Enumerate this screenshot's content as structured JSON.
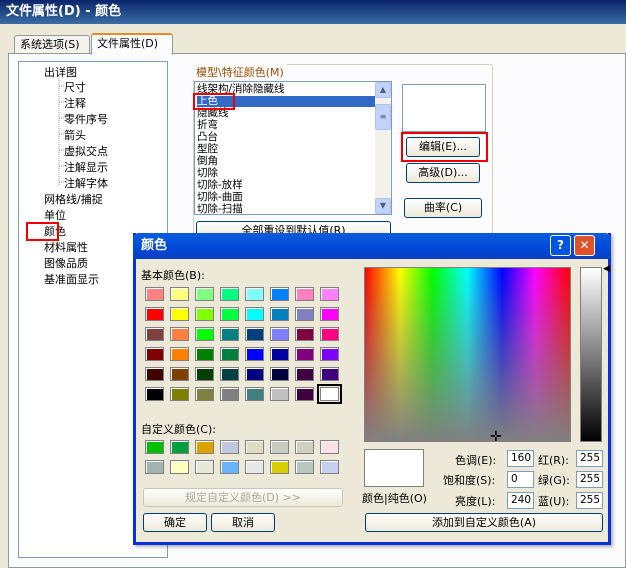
{
  "window": {
    "title": "文件属性(D) - 颜色"
  },
  "tabs": [
    {
      "label": "系统选项(S)"
    },
    {
      "label": "文件属性(D)"
    }
  ],
  "tree": {
    "items": [
      {
        "label": "出详图"
      },
      {
        "label": "尺寸"
      },
      {
        "label": "注释"
      },
      {
        "label": "零件序号"
      },
      {
        "label": "箭头"
      },
      {
        "label": "虚拟交点"
      },
      {
        "label": "注解显示"
      },
      {
        "label": "注解字体"
      },
      {
        "label": "网格线/捕捉"
      },
      {
        "label": "单位"
      },
      {
        "label": "颜色"
      },
      {
        "label": "材料属性"
      },
      {
        "label": "图像品质"
      },
      {
        "label": "基准面显示"
      }
    ]
  },
  "model_colors": {
    "group_label": "模型\\特征颜色(M)",
    "items": [
      "线架构/消除隐藏线",
      "上色",
      "隐藏线",
      "折弯",
      "凸台",
      "型腔",
      "倒角",
      "切除",
      "切除-放样",
      "切除-曲面",
      "切除-扫描"
    ],
    "selected_index": 1,
    "edit_button": "编辑(E)...",
    "advanced_button": "高级(D)...",
    "curvature_button": "曲率(C)",
    "reset_button": "全部重设到默认值(R)"
  },
  "color_dialog": {
    "title": "颜色",
    "help_btn": "?",
    "close_btn": "✕",
    "basic_colors_label": "基本颜色(B):",
    "basic_colors": [
      "#ff8080",
      "#ffff80",
      "#80ff80",
      "#00ff80",
      "#80ffff",
      "#0080ff",
      "#ff80c0",
      "#ff80ff",
      "#ff0000",
      "#ffff00",
      "#80ff00",
      "#00ff40",
      "#00ffff",
      "#0080c0",
      "#8080c0",
      "#ff00ff",
      "#804040",
      "#ff8040",
      "#00ff00",
      "#008080",
      "#004080",
      "#8080ff",
      "#800040",
      "#ff0080",
      "#800000",
      "#ff8000",
      "#008000",
      "#008040",
      "#0000ff",
      "#0000a0",
      "#800080",
      "#8000ff",
      "#400000",
      "#804000",
      "#004000",
      "#004040",
      "#000080",
      "#000040",
      "#400040",
      "#400080",
      "#000000",
      "#808000",
      "#808040",
      "#808080",
      "#408080",
      "#c0c0c0",
      "#400040",
      "#ffffff"
    ],
    "selected_basic_index": 47,
    "custom_colors_label": "自定义颜色(C):",
    "custom_colors": [
      "#00c000",
      "#00a040",
      "#e0a000",
      "#c0c8e0",
      "#e0dcc0",
      "#c8ccc0",
      "#d0d0c0",
      "#ffe0e8",
      "#a0b4b0",
      "#ffffc0",
      "#e8e8d8",
      "#6ab4ff",
      "#e8e8e8",
      "#d8d000",
      "#b8c8c0",
      "#c8d0f0"
    ],
    "define_custom_button": "规定自定义颜色(D) >>",
    "ok_button": "确定",
    "cancel_button": "取消",
    "color_solid_label": "颜色|纯色(O)",
    "hue_label": "色调(E):",
    "hue": "160",
    "sat_label": "饱和度(S):",
    "sat": "0",
    "lum_label": "亮度(L):",
    "lum": "240",
    "red_label": "红(R):",
    "red": "255",
    "green_label": "绿(G):",
    "green": "255",
    "blue_label": "蓝(U):",
    "blue": "255",
    "add_custom_button": "添加到自定义颜色(A)",
    "current_color": "#ffffff"
  }
}
